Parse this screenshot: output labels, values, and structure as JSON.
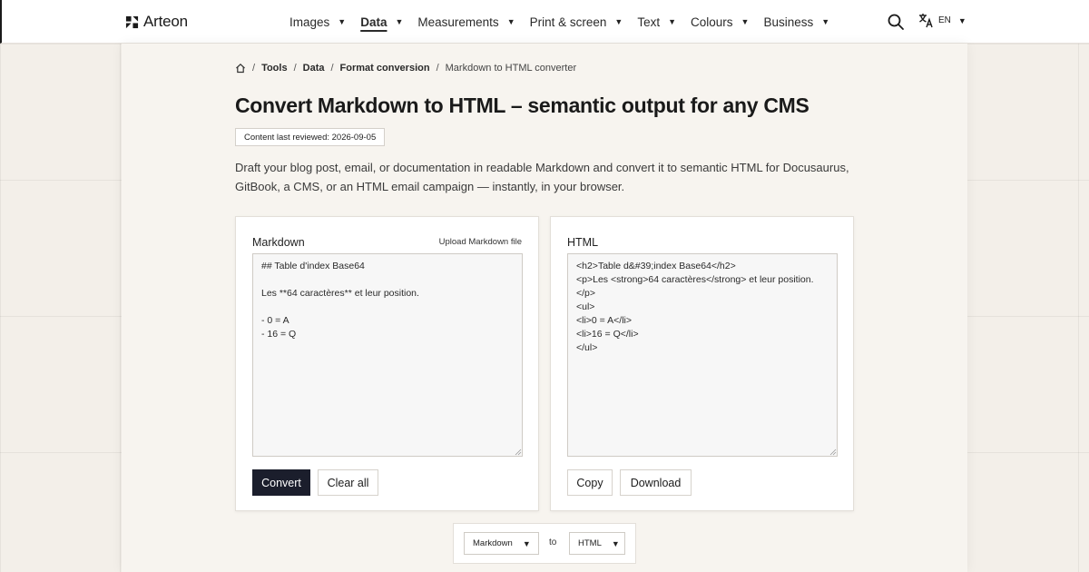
{
  "header": {
    "brand": "Arteon",
    "nav": [
      {
        "label": "Images",
        "active": false
      },
      {
        "label": "Data",
        "active": true
      },
      {
        "label": "Measurements",
        "active": false
      },
      {
        "label": "Print & screen",
        "active": false
      },
      {
        "label": "Text",
        "active": false
      },
      {
        "label": "Colours",
        "active": false
      },
      {
        "label": "Business",
        "active": false
      }
    ],
    "language": "EN",
    "icons": [
      "search-icon",
      "translate-icon",
      "chevron-down-icon"
    ]
  },
  "breadcrumb": {
    "items": [
      "Tools",
      "Data",
      "Format conversion"
    ],
    "current": "Markdown to HTML converter"
  },
  "page": {
    "title": "Convert Markdown to HTML – semantic output for any CMS",
    "reviewed": "Content last reviewed: 2026-09-05",
    "intro": "Draft your blog post, email, or documentation in readable Markdown and convert it to semantic HTML for Docusaurus, GitBook, a CMS, or an HTML email campaign — instantly, in your browser."
  },
  "markdown_panel": {
    "label": "Markdown",
    "upload_label": "Upload Markdown file",
    "content": "## Table d'index Base64\n\nLes **64 caractères** et leur position.\n\n- 0 = A\n- 16 = Q",
    "convert_label": "Convert",
    "clear_label": "Clear all"
  },
  "html_panel": {
    "label": "HTML",
    "content": "<h2>Table d&#39;index Base64</h2>\n<p>Les <strong>64 caractères</strong> et leur position.</p>\n<ul>\n<li>0 = A</li>\n<li>16 = Q</li>\n</ul>",
    "copy_label": "Copy",
    "download_label": "Download"
  },
  "format_bar": {
    "from": "Markdown",
    "to_word": "to",
    "to": "HTML"
  },
  "colors": {
    "primary_button": "#1b1e2c",
    "page_background": "#f3efe9",
    "sheet_background": "#f7f4ef"
  }
}
